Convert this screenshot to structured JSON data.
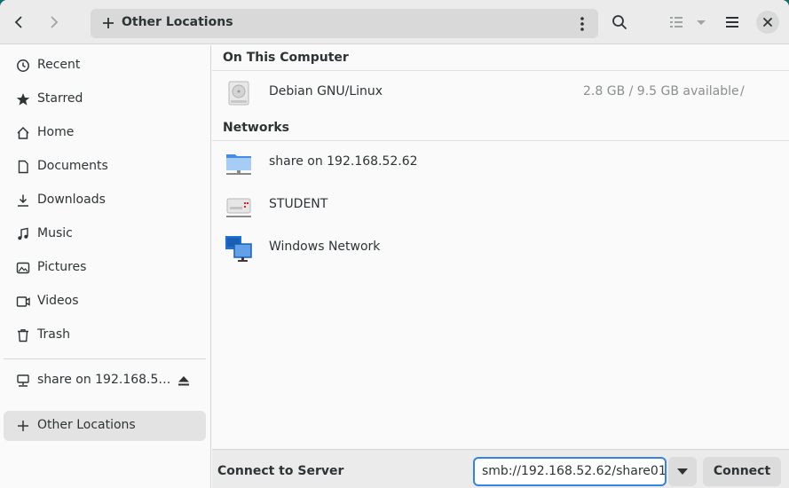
{
  "header": {
    "location_label": "Other Locations"
  },
  "sidebar": {
    "items": [
      {
        "label": "Recent",
        "icon": "clock-icon"
      },
      {
        "label": "Starred",
        "icon": "star-icon"
      },
      {
        "label": "Home",
        "icon": "home-icon"
      },
      {
        "label": "Documents",
        "icon": "document-icon"
      },
      {
        "label": "Downloads",
        "icon": "download-icon"
      },
      {
        "label": "Music",
        "icon": "music-icon"
      },
      {
        "label": "Pictures",
        "icon": "picture-icon"
      },
      {
        "label": "Videos",
        "icon": "video-icon"
      },
      {
        "label": "Trash",
        "icon": "trash-icon"
      }
    ],
    "mounted": {
      "label": "share on 192.168.5…",
      "icon": "network-share-icon"
    },
    "other_locations": {
      "label": "Other Locations",
      "icon": "plus-icon"
    }
  },
  "main": {
    "on_this_computer_heading": "On This Computer",
    "computer_items": [
      {
        "name": "Debian GNU/Linux",
        "info": "2.8 GB / 9.5 GB available",
        "path": "/",
        "icon": "drive-harddisk-icon"
      }
    ],
    "networks_heading": "Networks",
    "network_items": [
      {
        "name": "share on 192.168.52.62",
        "icon": "network-folder-icon"
      },
      {
        "name": "STUDENT",
        "icon": "network-server-icon"
      },
      {
        "name": "Windows Network",
        "icon": "windows-network-icon"
      }
    ]
  },
  "bottom": {
    "connect_label": "Connect to Server",
    "server_address": "smb://192.168.52.62/share01 �",
    "connect_button": "Connect"
  },
  "colors": {
    "accent": "#3584e4",
    "window_bg": "#fafafa",
    "headerbar_bg": "#ebebeb"
  }
}
